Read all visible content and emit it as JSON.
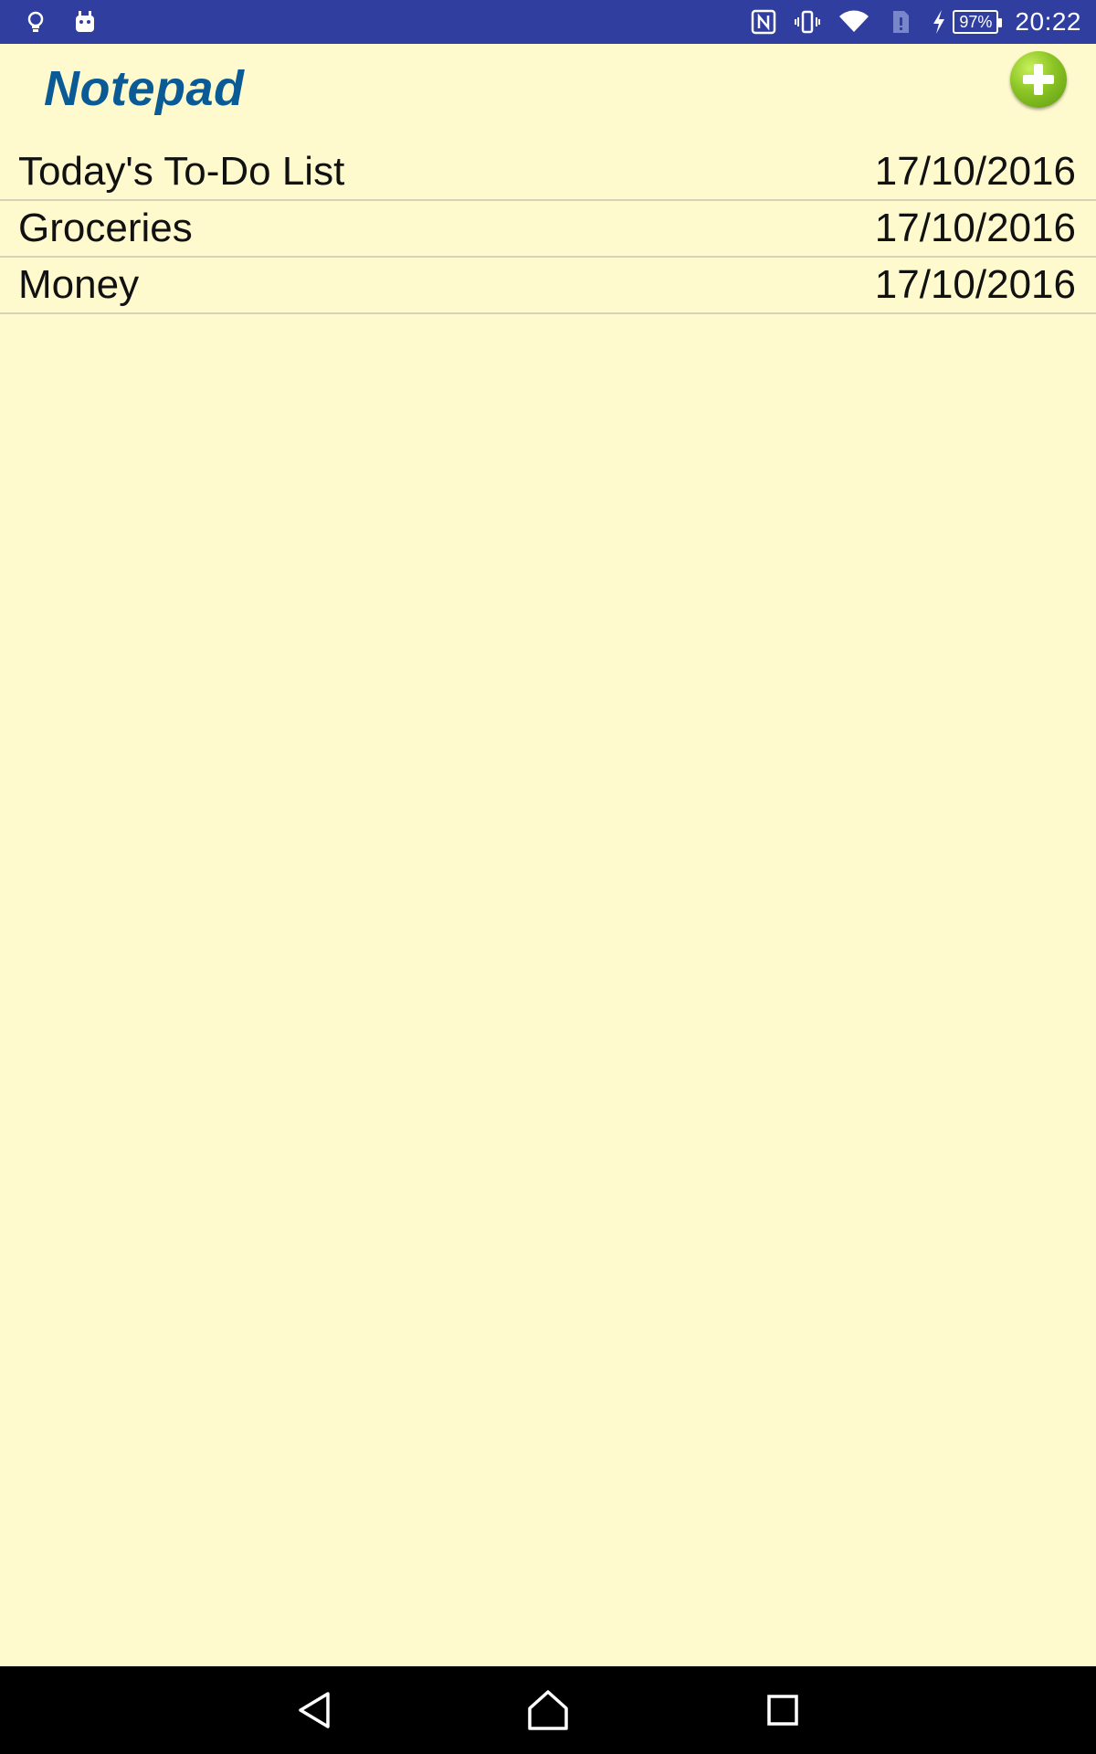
{
  "status_bar": {
    "time": "20:22",
    "battery_level": "97%",
    "icons": [
      "bulb-icon",
      "android-icon",
      "nfc-icon",
      "vibrate-icon",
      "wifi-icon",
      "sim-alert-icon",
      "charging-icon",
      "battery-icon"
    ]
  },
  "app": {
    "title": "Notepad",
    "add_icon": "add-note-icon",
    "accent_color": "#0A5A96",
    "background_color": "#FFFACD"
  },
  "notes": [
    {
      "title": "Today's To-Do List",
      "date": "17/10/2016"
    },
    {
      "title": "Groceries",
      "date": "17/10/2016"
    },
    {
      "title": "Money",
      "date": "17/10/2016"
    }
  ],
  "nav_bar": {
    "icons": [
      "back-icon",
      "home-icon",
      "recents-icon"
    ]
  }
}
